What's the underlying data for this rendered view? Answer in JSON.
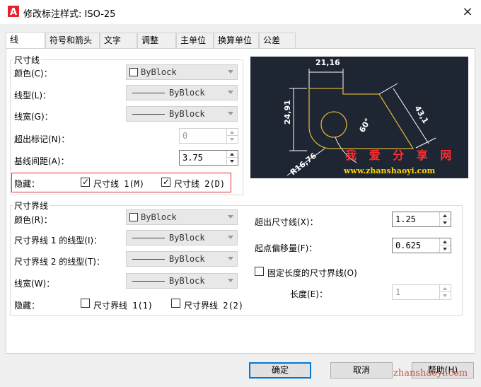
{
  "window": {
    "title": "修改标注样式: ISO-25",
    "logo_letter": "A",
    "close": "×"
  },
  "tabs": [
    "线",
    "符号和箭头",
    "文字",
    "调整",
    "主单位",
    "换算单位",
    "公差"
  ],
  "dim_lines": {
    "group_title": "尺寸线",
    "color_label": "颜色(C)：",
    "color_value": "ByBlock",
    "linetype_label": "线型(L)：",
    "linetype_value": "ByBlock",
    "lineweight_label": "线宽(G)：",
    "lineweight_value": "ByBlock",
    "extend_label": "超出标记(N)：",
    "extend_value": "0",
    "baseline_label": "基线间距(A)：",
    "baseline_value": "3.75",
    "suppress_label": "隐藏：",
    "suppress_1": "尺寸线 1(M)",
    "suppress_2": "尺寸线 2(D)"
  },
  "ext_lines": {
    "group_title": "尺寸界线",
    "color_label": "颜色(R)：",
    "color_value": "ByBlock",
    "linetype1_label": "尺寸界线 1 的线型(I)：",
    "linetype1_value": "ByBlock",
    "linetype2_label": "尺寸界线 2 的线型(T)：",
    "linetype2_value": "ByBlock",
    "lineweight_label": "线宽(W)：",
    "lineweight_value": "ByBlock",
    "suppress_label": "隐藏：",
    "suppress_1": "尺寸界线 1(1)",
    "suppress_2": "尺寸界线 2(2)",
    "extend_label": "超出尺寸线(X)：",
    "extend_value": "1.25",
    "offset_label": "起点偏移量(F)：",
    "offset_value": "0.625",
    "fixed_label": "固定长度的尺寸界线(O)",
    "length_label": "长度(E)：",
    "length_value": "1"
  },
  "preview": {
    "dim_top": "21,16",
    "dim_left": "24,91",
    "dim_right": "43,1",
    "dim_angle": "60°",
    "dim_radius": "R16,76",
    "watermark_cn": "我 爱 分 享 网",
    "watermark_url": "www.zhanshaoyi.com"
  },
  "buttons": {
    "ok": "确定",
    "cancel": "取消",
    "help": "帮助(H)"
  },
  "footer_watermark": "zhanshaoyi.com",
  "colors": {
    "accent": "#0078d7",
    "logo_red": "#e8202a",
    "preview_bg": "#1e2533",
    "preview_line": "#d8b13a",
    "highlight_box": "#e03030"
  }
}
